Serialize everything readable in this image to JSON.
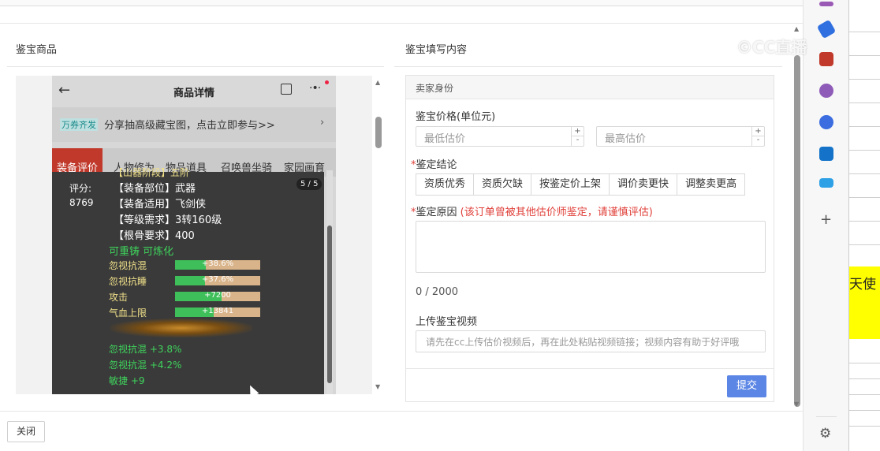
{
  "window": {
    "left_title": "鉴宝商品",
    "right_title": "鉴宝填写内容",
    "close_button": "关闭"
  },
  "phone": {
    "title": "商品详情",
    "promo_tag": "万券齐发",
    "promo_text": "分享抽高级藏宝图，点击立即参与>>",
    "tabs": [
      "装备评价",
      "人物修为",
      "物品道具",
      "召唤兽坐骑",
      "家园画育"
    ],
    "score_label": "评分:",
    "score_value": "8769",
    "page_badge": "5 / 5",
    "attributes": [
      "【装备部位】武器",
      "【装备适用】飞剑侠",
      "【等级需求】3转160级",
      "【根骨要求】400"
    ],
    "attr_top_partial": "【山器阶段】五阶",
    "reforge": "可重铸 可炼化",
    "stats": [
      {
        "label": "忽视抗混",
        "value": "+38.6%",
        "fill": 0.36
      },
      {
        "label": "忽视抗睡",
        "value": "+37.6%",
        "fill": 0.35
      },
      {
        "label": "攻击",
        "value": "+7200",
        "fill": 0.55
      },
      {
        "label": "气血上限",
        "value": "+13841",
        "fill": 0.45
      }
    ],
    "bonus_lines": [
      "忽视抗混 +3.8%",
      "忽视抗混 +4.2%",
      "敏捷 +9"
    ]
  },
  "form": {
    "seller_header": "卖家身份",
    "price_label": "鉴宝价格(单位元)",
    "min_placeholder": "最低估价",
    "max_placeholder": "最高估价",
    "conclusion_label": "鉴定结论",
    "conclusion_options": [
      "资质优秀",
      "资质欠缺",
      "按鉴定价上架",
      "调价卖更快",
      "调整卖更高"
    ],
    "reason_label": "鉴定原因",
    "reason_warning": "(该订单曾被其他估价师鉴定，请谨慎评估)",
    "char_count": "0 / 2000",
    "video_label": "上传鉴宝视频",
    "video_placeholder": "请先在cc上传估价视频后，再在此处粘贴视频链接；视频内容有助于好评哦",
    "submit": "提交",
    "required_mark": "*"
  },
  "strip": {
    "cell_text": "天使"
  },
  "watermark": "©CC直播",
  "icons": [
    "back-arrow-icon",
    "share-icon",
    "more-icon",
    "chevron-right-icon",
    "plus-icon",
    "gear-icon"
  ],
  "colors": {
    "accent_blue": "#5b86e5",
    "warning_red": "#e0403a",
    "stat_green": "#3fbf5a",
    "highlight_yellow": "#ffff00"
  }
}
